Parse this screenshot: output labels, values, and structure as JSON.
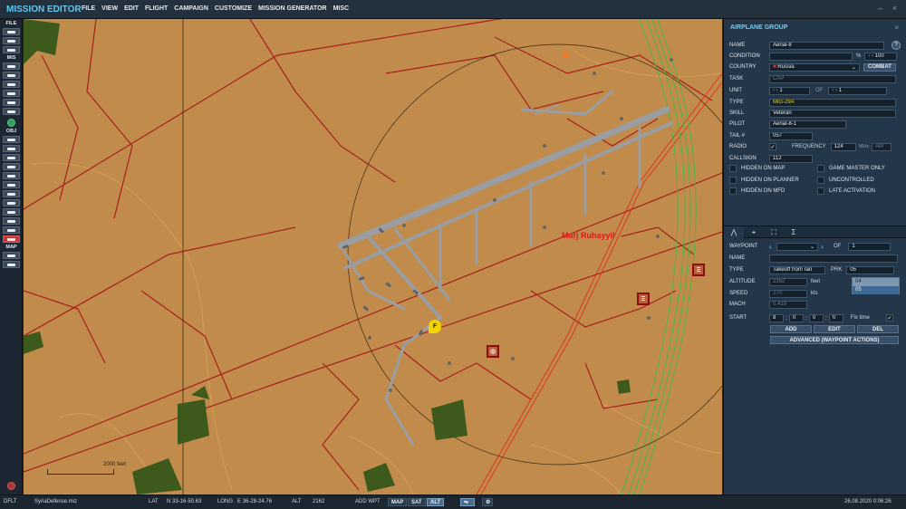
{
  "app": {
    "title": "MISSION EDITOR",
    "menu": [
      "FILE",
      "VIEW",
      "EDIT",
      "FLIGHT",
      "CAMPAIGN",
      "CUSTOMIZE",
      "MISSION GENERATOR",
      "MISC"
    ],
    "minimize": "–",
    "close": "×"
  },
  "leftbar": {
    "file_label": "FILE",
    "mis_label": "MIS",
    "obj_label": "OBJ",
    "map_label": "MAP"
  },
  "map": {
    "town_label": "Marj Ruhayyil",
    "scale_label": "2000 feet",
    "flight_marker": "F",
    "sam_marker_1": "Ξ",
    "sam_marker_2": "Ξ",
    "sam_marker_3": "◎"
  },
  "panel": {
    "title": "AIRPLANE GROUP",
    "close": "×",
    "help": "?",
    "name_label": "NAME",
    "name_value": "Aerial-8",
    "condition_label": "CONDITION",
    "condition_unit": "%",
    "condition_value": "100",
    "country_label": "COUNTRY",
    "country_value": "Russia",
    "combat_button": "COMBAT",
    "task_label": "TASK",
    "task_value": "CAP",
    "unit_label": "UNIT",
    "unit_value": "1",
    "of_label": "OF",
    "unit_of_value": "1",
    "type_label": "TYPE",
    "type_value": "MiG-29A",
    "skill_label": "SKILL",
    "skill_value": "Veteran",
    "pilot_label": "PILOT",
    "pilot_value": "Aerial-8-1",
    "tail_label": "TAIL #",
    "tail_value": "057",
    "radio_label": "RADIO",
    "frequency_label": "FREQUENCY",
    "frequency_value": "124",
    "frequency_unit": "MHz",
    "modulation": "AM",
    "callsign_label": "CALLSIGN",
    "callsign_value": "112",
    "checkboxes": [
      "HIDDEN ON MAP",
      "GAME MASTER ONLY",
      "HIDDEN ON PLANNER",
      "UNCONTROLLED",
      "HIDDEN ON MFD",
      "LATE ACTIVATION"
    ],
    "wp": {
      "tabs": [
        "⋀",
        "⌖",
        "⛶",
        "Σ"
      ],
      "waypoint_label": "WAYPOINT",
      "of_label": "OF",
      "of_value": "1",
      "name_label": "NAME",
      "type_label": "TYPE",
      "type_value": "Takeoff from ran",
      "prk_label": "PRK",
      "prk_value": "05",
      "prk_options": [
        "04",
        "05"
      ],
      "altitude_label": "ALTITUDE",
      "altitude_value": "2162",
      "altitude_unit": "feet",
      "speed_label": "SPEED",
      "speed_value": "270",
      "speed_unit": "kts",
      "mach_label": "MACH",
      "mach_value": "0.418",
      "start_label": "START",
      "start_d": "8",
      "start_h": "0",
      "start_m": "0",
      "start_s": "0",
      "fix_time_label": "Fix time",
      "add_button": "ADD",
      "edit_button": "EDIT",
      "del_button": "DEL",
      "advanced_button": "ADVANCED (WAYPOINT ACTIONS)"
    }
  },
  "status": {
    "mode": "DFLT",
    "file": "SyriaDefense.miz",
    "lat_label": "LAT",
    "lat_value": "N 33-16-50.63",
    "long_label": "LONG",
    "long_value": "E 36-28-24.76",
    "alt_label": "ALT",
    "alt_value": "2162",
    "add_wpt": "ADD WPT",
    "map_btn": "MAP",
    "sat_btn": "SAT",
    "alt_btn": "ALT",
    "datetime": "26.08.2020 0:06:26"
  },
  "colors": {
    "map_bg": "#c18b4b",
    "panel_bg": "#23364a",
    "accent": "#5ec8f0",
    "road_red": "#a8201d",
    "runway": "#9a9ea3",
    "green_route": "#3fbf3f"
  }
}
